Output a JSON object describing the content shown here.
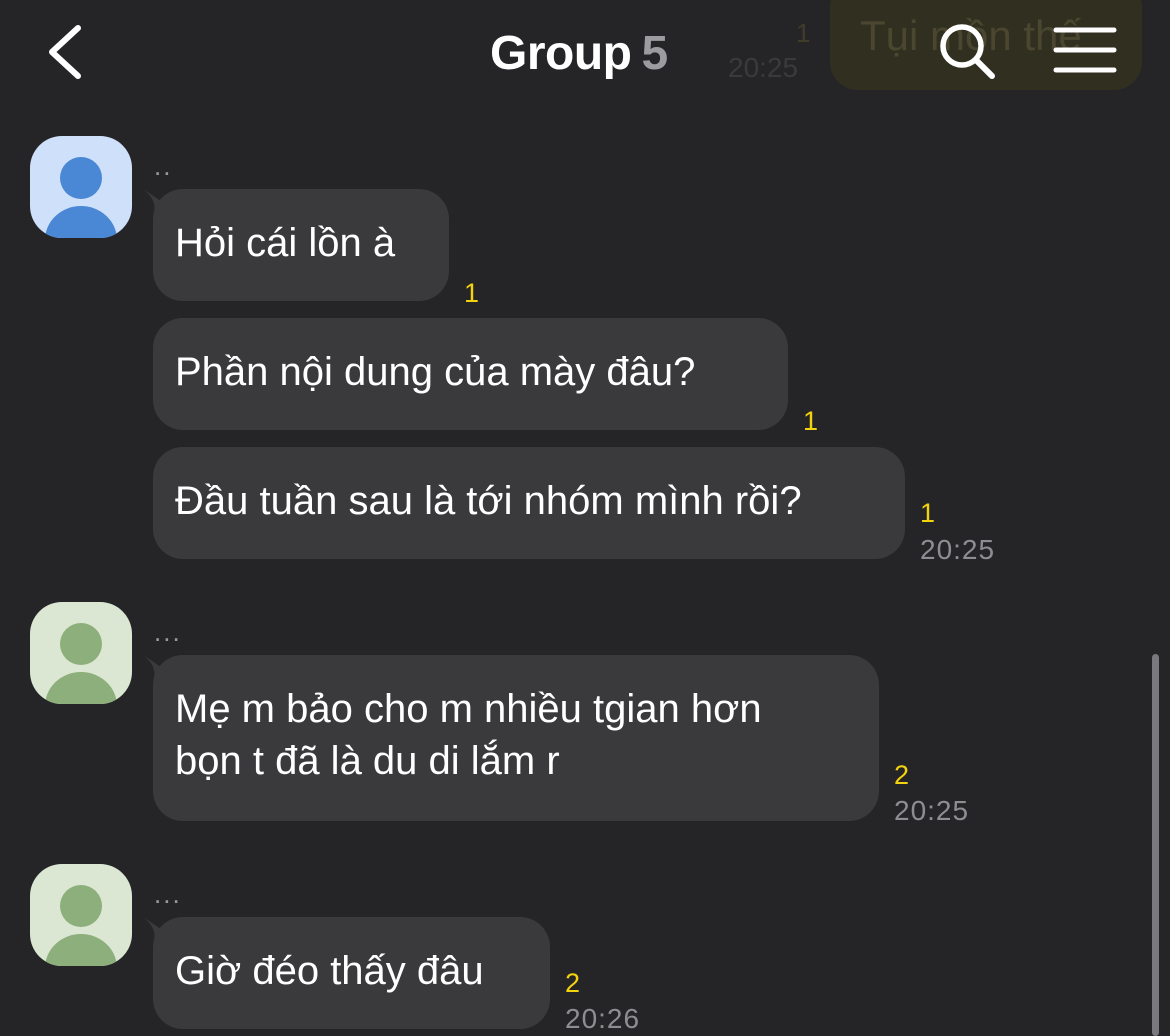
{
  "header": {
    "title": "Group",
    "member_count": "5",
    "back_icon": "chevron-left-icon",
    "search_icon": "search-icon",
    "menu_icon": "hamburger-menu-icon"
  },
  "ghost_message": {
    "text": "Tụi mồn thế",
    "unread": "1",
    "time": "20:25"
  },
  "groups": [
    {
      "sender": "..",
      "avatar_color": "#4a87d4",
      "messages": [
        {
          "text": "Hỏi cái lồn à",
          "unread": "1"
        },
        {
          "text": "Phần nội dung của mày đâu?",
          "unread": "1"
        },
        {
          "text": "Đầu tuần sau là tới nhóm mình rồi?",
          "unread": "1",
          "time": "20:25"
        }
      ]
    },
    {
      "sender": "...",
      "avatar_color": "#8daf7c",
      "messages": [
        {
          "text_line1": "Mẹ m bảo cho m nhiều tgian hơn",
          "text_line2": "bọn t đã là du di lắm r",
          "unread": "2",
          "time": "20:25"
        }
      ]
    },
    {
      "sender": "...",
      "avatar_color": "#8daf7c",
      "messages": [
        {
          "text": "Giờ đéo thấy đâu",
          "unread": "2",
          "time": "20:26"
        }
      ]
    }
  ],
  "colors": {
    "background": "#252528",
    "bubble": "#3a3a3d",
    "unread_count": "#f3d20e",
    "timestamp": "#8e8e92"
  }
}
